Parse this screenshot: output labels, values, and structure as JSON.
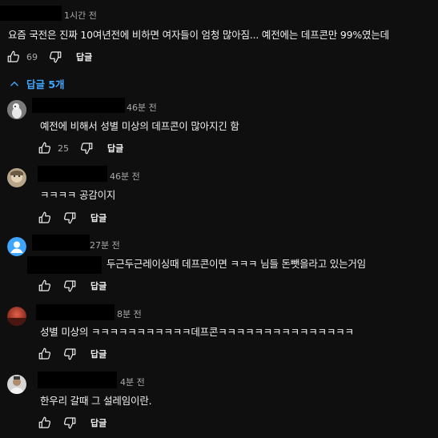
{
  "top_comment": {
    "time": "1시간 전",
    "text": "요즘 국전은 진짜 10여년전에 비하면 여자들이 엄청 많아짐...  예전에는 데프콘만 99%였는데",
    "likes": "69",
    "reply_label": "답글"
  },
  "replies_toggle": {
    "label": "답글 5개",
    "icon": "chevron-up-icon",
    "color": "#3ea6ff"
  },
  "replies": [
    {
      "time": "46분 전",
      "text": "예전에 비해서 성별 미상의 데프콘이 많아지긴 함",
      "likes": "25",
      "reply_label": "답글"
    },
    {
      "time": "46분 전",
      "text": "ㅋㅋㅋㅋ  공감이지",
      "likes": "",
      "reply_label": "답글"
    },
    {
      "time": "27분 전",
      "text": "두근두근레이싱때 데프콘이면 ㅋㅋㅋ 님들 돈뺏을라고 있는거임",
      "likes": "",
      "reply_label": "답글"
    },
    {
      "time": "8분 전",
      "text": "성별 미상의 ㅋㅋㅋㅋㅋㅋㅋㅋㅋㅋㅋ데프콘ㅋㅋㅋㅋㅋㅋㅋㅋㅋㅋㅋㅋㅋㅋㅋ",
      "likes": "",
      "reply_label": "답글"
    },
    {
      "time": "4분 전",
      "text": "한우리 갈때 그 설레임이란.",
      "likes": "",
      "reply_label": "답글"
    }
  ],
  "icons": {
    "like": "thumbs-up-icon",
    "dislike": "thumbs-down-icon"
  }
}
